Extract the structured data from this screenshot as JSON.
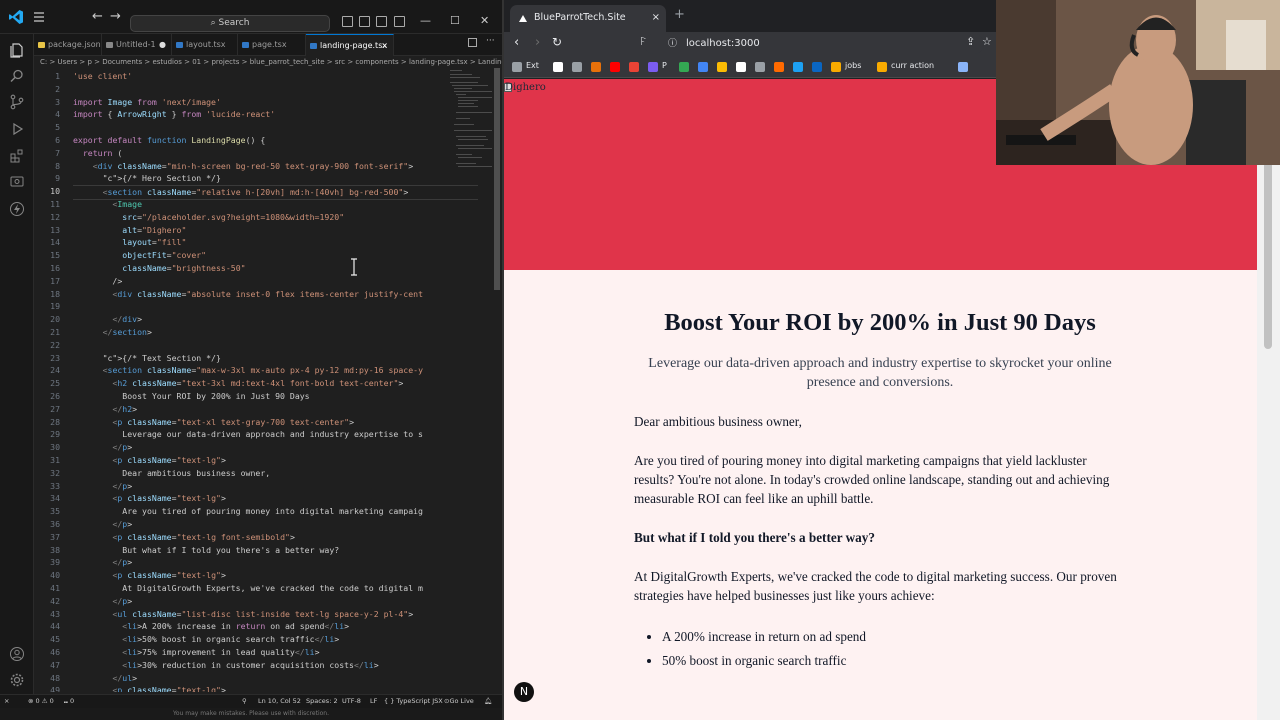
{
  "vscode": {
    "search_label": "Search",
    "tabs": [
      {
        "label": "package.json",
        "color": "#e8c547"
      },
      {
        "label": "Untitled-1",
        "color": "#888888",
        "modified": "●"
      },
      {
        "label": "layout.tsx",
        "color": "#3178c6"
      },
      {
        "label": "page.tsx",
        "color": "#3178c6"
      },
      {
        "label": "landing-page.tsx",
        "color": "#3178c6",
        "close": "×"
      }
    ],
    "breadcrumb": "C: > Users > p > Documents > estudios > 01 > projects > blue_parrot_tech_site > src > components > landing-page.tsx > LandingPage",
    "current_line": 10,
    "code_lines": [
      "'use client'",
      "",
      "import Image from 'next/image'",
      "import { ArrowRight } from 'lucide-react'",
      "",
      "export default function LandingPage() {",
      "  return (",
      "    <div className=\"min-h-screen bg-red-50 text-gray-900 font-serif\">",
      "      {/* Hero Section */}",
      "      <section className=\"relative h-[20vh] md:h-[40vh] bg-red-500\">",
      "        <Image",
      "          src=\"/placeholder.svg?height=1080&width=1920\"",
      "          alt=\"Dighero\"",
      "          layout=\"fill\"",
      "          objectFit=\"cover\"",
      "          className=\"brightness-50\"",
      "        />",
      "        <div className=\"absolute inset-0 flex items-center justify-cent",
      "",
      "        </div>",
      "      </section>",
      "",
      "      {/* Text Section */}",
      "      <section className=\"max-w-3xl mx-auto px-4 py-12 md:py-16 space-y",
      "        <h2 className=\"text-3xl md:text-4xl font-bold text-center\">",
      "          Boost Your ROI by 200% in Just 90 Days",
      "        </h2>",
      "        <p className=\"text-xl text-gray-700 text-center\">",
      "          Leverage our data-driven approach and industry expertise to s",
      "        </p>",
      "        <p className=\"text-lg\">",
      "          Dear ambitious business owner,",
      "        </p>",
      "        <p className=\"text-lg\">",
      "          Are you tired of pouring money into digital marketing campaig",
      "        </p>",
      "        <p className=\"text-lg font-semibold\">",
      "          But what if I told you there's a better way?",
      "        </p>",
      "        <p className=\"text-lg\">",
      "          At DigitalGrowth Experts, we've cracked the code to digital m",
      "        </p>",
      "        <ul className=\"list-disc list-inside text-lg space-y-2 pl-4\">",
      "          <li>A 200% increase in return on ad spend</li>",
      "          <li>50% boost in organic search traffic</li>",
      "          <li>75% improvement in lead quality</li>",
      "          <li>30% reduction in customer acquisition costs</li>",
      "        </ul>",
      "        <p className=\"text-lg\">"
    ],
    "status": {
      "errors": "⊗ 0 ⚠ 0",
      "ports": "⑉ 0",
      "position": "Ln 10, Col 52",
      "spaces": "Spaces: 2",
      "encoding": "UTF-8",
      "eol": "LF",
      "language": "{ } TypeScript JSX",
      "golive": "Go Live"
    },
    "notice": "You may make mistakes. Please use with discretion."
  },
  "browser": {
    "tab_title": "BlueParrotTech.Site",
    "tab_close": "×",
    "new_tab": "+",
    "url": "localhost:3000",
    "bookmarks": [
      {
        "label": "Ext",
        "color": "#9aa0a6"
      },
      {
        "label": "",
        "color": "#ffffff"
      },
      {
        "label": "",
        "color": "#9aa0a6"
      },
      {
        "label": "",
        "color": "#e8710a"
      },
      {
        "label": "",
        "color": "#ff0000"
      },
      {
        "label": "",
        "color": "#ea4335"
      },
      {
        "label": "P",
        "color": "#7b5cf0"
      },
      {
        "label": "",
        "color": "#34a853"
      },
      {
        "label": "",
        "color": "#4285f4"
      },
      {
        "label": "",
        "color": "#fbbc04"
      },
      {
        "label": "",
        "color": "#ffffff"
      },
      {
        "label": "",
        "color": "#9aa0a6"
      },
      {
        "label": "",
        "color": "#ff6a00"
      },
      {
        "label": "",
        "color": "#1da1f2"
      },
      {
        "label": "",
        "color": "#0a66c2"
      },
      {
        "label": "jobs",
        "color": "#f9ab00"
      },
      {
        "label": "curr action",
        "color": "#f9ab00"
      },
      {
        "label": "",
        "color": "#8ab4f8"
      }
    ]
  },
  "page": {
    "hero_alt": "Dighero",
    "hero_color": "#e0344a",
    "background": "#fef2f2",
    "headline": "Boost Your ROI by 200% in Just 90 Days",
    "subhead": "Leverage our data-driven approach and industry expertise to skyrocket your online presence and conversions.",
    "greeting": "Dear ambitious business owner,",
    "problem": "Are you tired of pouring money into digital marketing campaigns that yield lackluster results? You're not alone. In today's crowded online landscape, standing out and achieving measurable ROI can feel like an uphill battle.",
    "hook": "But what if I told you there's a better way?",
    "intro": "At DigitalGrowth Experts, we've cracked the code to digital marketing success. Our proven strategies have helped businesses just like yours achieve:",
    "benefits": [
      "A 200% increase in return on ad spend",
      "50% boost in organic search traffic"
    ],
    "nextjs_badge": "N"
  }
}
